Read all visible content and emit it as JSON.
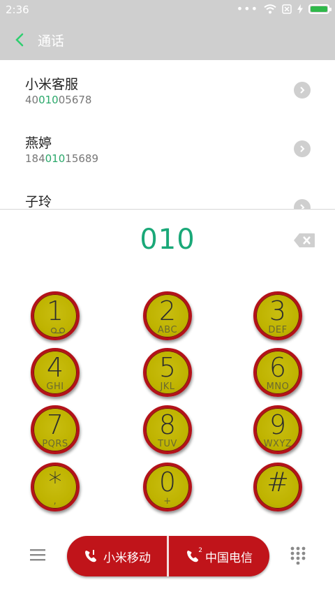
{
  "status": {
    "time": "2:36",
    "dots": "•••"
  },
  "header": {
    "title": "通话"
  },
  "contacts": [
    {
      "name": "小米客服",
      "num_pre": "40",
      "num_hl": "010",
      "num_post": "05678"
    },
    {
      "name": "燕婷",
      "num_pre": "184",
      "num_hl": "010",
      "num_post": "15689"
    },
    {
      "name": "子玲",
      "num_pre": "",
      "num_hl": "",
      "num_post": ""
    }
  ],
  "dialer": {
    "number": "010"
  },
  "keys": [
    {
      "digit": "1",
      "letters": ""
    },
    {
      "digit": "2",
      "letters": "ABC"
    },
    {
      "digit": "3",
      "letters": "DEF"
    },
    {
      "digit": "4",
      "letters": "GHI"
    },
    {
      "digit": "5",
      "letters": "JKL"
    },
    {
      "digit": "6",
      "letters": "MNO"
    },
    {
      "digit": "7",
      "letters": "PQRS"
    },
    {
      "digit": "8",
      "letters": "TUV"
    },
    {
      "digit": "9",
      "letters": "WXYZ"
    },
    {
      "digit": "*",
      "letters": ","
    },
    {
      "digit": "0",
      "letters": "+"
    },
    {
      "digit": "#",
      "letters": ""
    }
  ],
  "call": {
    "sim1_label": "小米移动",
    "sim2_label": "中国电信",
    "sim2_badge": "2"
  },
  "colors": {
    "accent": "#1aa878",
    "call_red": "#c0141a",
    "key_yellow": "#bfb300"
  }
}
